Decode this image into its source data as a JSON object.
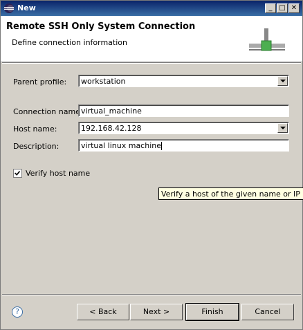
{
  "window": {
    "title": "New"
  },
  "header": {
    "title": "Remote SSH Only System Connection",
    "description": "Define connection information"
  },
  "form": {
    "parent_profile": {
      "label": "Parent profile:",
      "value": "workstation"
    },
    "connection_name": {
      "label": "Connection name:",
      "value": "virtual_machine"
    },
    "host_name": {
      "label": "Host name:",
      "value": "192.168.42.128"
    },
    "description": {
      "label": "Description:",
      "value": "virtual linux machine"
    },
    "verify_host": {
      "label": "Verify host name",
      "checked": true
    }
  },
  "tooltip": {
    "text": "Verify a host of the given name or IP addre"
  },
  "buttons": {
    "back": "< Back",
    "next": "Next >",
    "finish": "Finish",
    "cancel": "Cancel",
    "help": "?"
  }
}
